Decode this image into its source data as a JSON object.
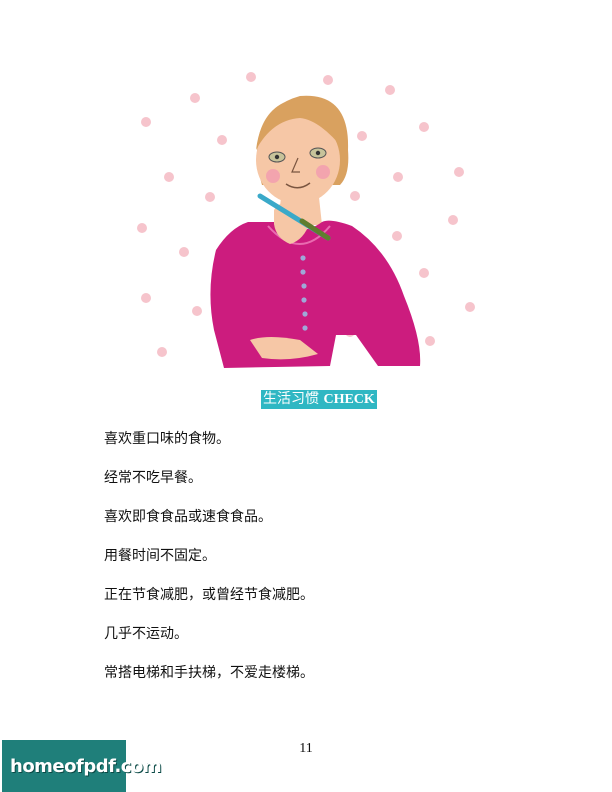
{
  "section": {
    "heading_cn": "生活习惯",
    "heading_en": "CHECK"
  },
  "items": [
    "喜欢重口味的食物。",
    "经常不吃早餐。",
    "喜欢即食食品或速食食品。",
    "用餐时间不固定。",
    "正在节食减肥，或曾经节食减肥。",
    "几乎不运动。",
    "常搭电梯和手扶梯，不爱走楼梯。"
  ],
  "page_number": "11",
  "watermark": {
    "text": "homeofpdf.com"
  },
  "colors": {
    "accent": "#2fb7c3",
    "sweater": "#cc1c7e",
    "dots": "#f6c4cc",
    "hair": "#d9a15f",
    "skin": "#f6c7a6"
  }
}
